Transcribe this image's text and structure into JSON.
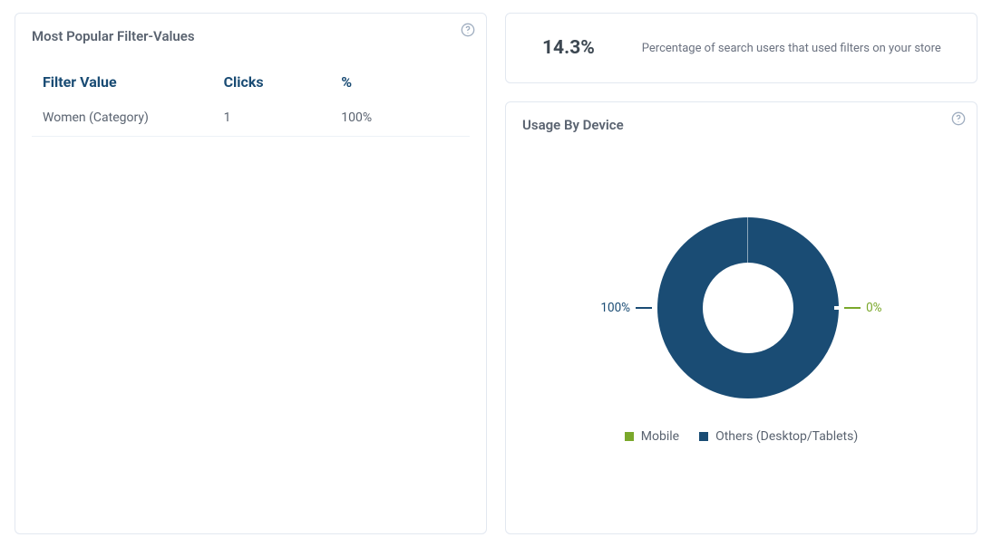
{
  "filter_card": {
    "title": "Most Popular Filter-Values",
    "headers": {
      "col1": "Filter Value",
      "col2": "Clicks",
      "col3": "%"
    },
    "rows": [
      {
        "value": "Women (Category)",
        "clicks": "1",
        "pct": "100%"
      }
    ]
  },
  "stat_card": {
    "value": "14.3%",
    "description": "Percentage of search users that used filters on your store"
  },
  "device_card": {
    "title": "Usage By Device",
    "left_label": "100%",
    "right_label": "0%",
    "legend": {
      "mobile": "Mobile",
      "others": "Others (Desktop/Tablets)"
    }
  },
  "chart_data": {
    "type": "pie",
    "title": "Usage By Device",
    "series": [
      {
        "name": "Others (Desktop/Tablets)",
        "value": 100,
        "color": "#1a4c74"
      },
      {
        "name": "Mobile",
        "value": 0,
        "color": "#7aa82b"
      }
    ]
  }
}
